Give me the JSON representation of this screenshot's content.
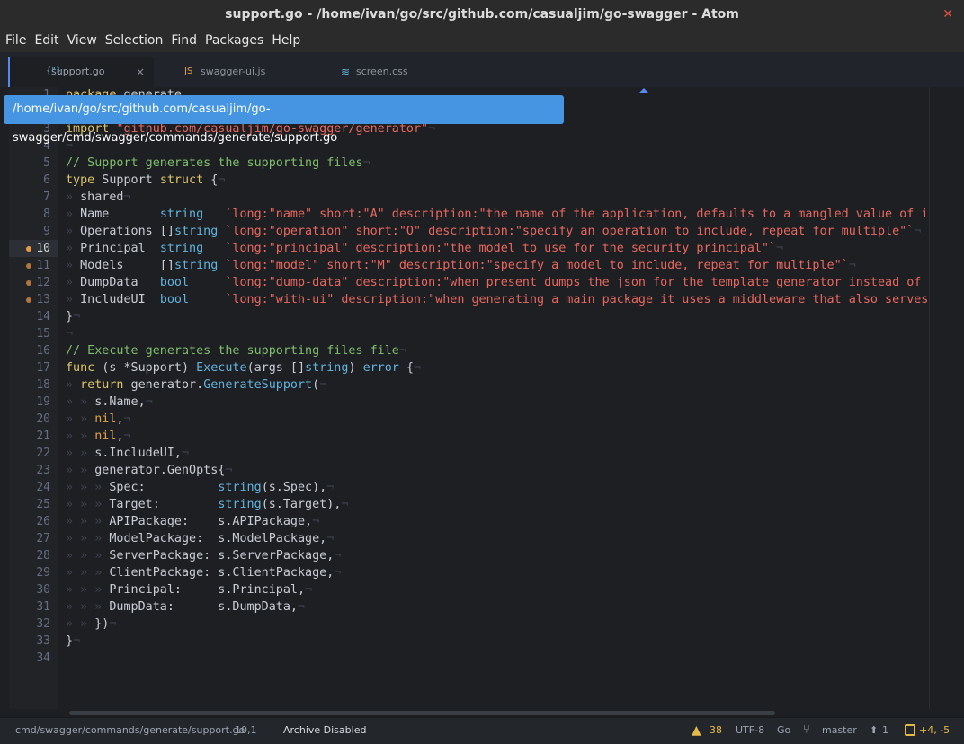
{
  "window": {
    "title": "support.go - /home/ivan/go/src/github.com/casualjim/go-swagger - Atom",
    "close_icon": "close-icon"
  },
  "menu": [
    "File",
    "Edit",
    "View",
    "Selection",
    "Find",
    "Packages",
    "Help"
  ],
  "tabs": [
    {
      "label": "support.go",
      "icon": "go-file-icon",
      "active": true,
      "close": "×"
    },
    {
      "label": "swagger-ui.js",
      "icon": "js-file-icon",
      "active": false
    },
    {
      "label": "screen.css",
      "icon": "css3-file-icon",
      "active": false
    }
  ],
  "tooltip": "/home/ivan/go/src/github.com/casualjim/go-swagger/cmd/swagger/commands/generate/support.go",
  "editor": {
    "current_line": 10,
    "modified_lines": [
      10,
      11,
      12,
      13
    ],
    "lines": [
      [
        [
          "k",
          "package"
        ],
        [
          "p",
          " generate"
        ]
      ],
      [],
      [
        [
          "k",
          "import"
        ],
        [
          "p",
          " "
        ],
        [
          "s",
          "\"github.com/casualjim/go-swagger/generator\""
        ],
        [
          "i",
          "¬"
        ]
      ],
      [
        [
          "i",
          "¬"
        ]
      ],
      [
        [
          "c",
          "// Support generates the supporting files"
        ],
        [
          "i",
          "¬"
        ]
      ],
      [
        [
          "k",
          "type"
        ],
        [
          "p",
          " Support "
        ],
        [
          "k",
          "struct"
        ],
        [
          "p",
          " {"
        ],
        [
          "i",
          "¬"
        ]
      ],
      [
        [
          "i",
          "» "
        ],
        [
          "p",
          "shared"
        ],
        [
          "i",
          "¬"
        ]
      ],
      [
        [
          "i",
          "» "
        ],
        [
          "p",
          "Name       "
        ],
        [
          "t",
          "string"
        ],
        [
          "p",
          "   "
        ],
        [
          "s",
          "`long:\"name\" short:\"A\" description:\"the name of the application, defaults to a mangled value of info.title\"`"
        ]
      ],
      [
        [
          "i",
          "» "
        ],
        [
          "p",
          "Operations []"
        ],
        [
          "t",
          "string"
        ],
        [
          "p",
          " "
        ],
        [
          "s",
          "`long:\"operation\" short:\"O\" description:\"specify an operation to include, repeat for multiple\"`"
        ],
        [
          "i",
          "¬"
        ]
      ],
      [
        [
          "i",
          "» "
        ],
        [
          "p",
          "Principal  "
        ],
        [
          "t",
          "string"
        ],
        [
          "p",
          "   "
        ],
        [
          "s",
          "`long:\"principal\" description:\"the model to use for the security principal\"`"
        ],
        [
          "i",
          "¬"
        ]
      ],
      [
        [
          "i",
          "» "
        ],
        [
          "p",
          "Models     []"
        ],
        [
          "t",
          "string"
        ],
        [
          "p",
          " "
        ],
        [
          "s",
          "`long:\"model\" short:\"M\" description:\"specify a model to include, repeat for multiple\"`"
        ],
        [
          "i",
          "¬"
        ]
      ],
      [
        [
          "i",
          "» "
        ],
        [
          "p",
          "DumpData   "
        ],
        [
          "t",
          "bool"
        ],
        [
          "p",
          "     "
        ],
        [
          "s",
          "`long:\"dump-data\" description:\"when present dumps the json for the template generator instead of generating files\"`"
        ]
      ],
      [
        [
          "i",
          "» "
        ],
        [
          "p",
          "IncludeUI  "
        ],
        [
          "t",
          "bool"
        ],
        [
          "p",
          "     "
        ],
        [
          "s",
          "`long:\"with-ui\" description:\"when generating a main package it uses a middleware that also serves a swagger-ui\"`"
        ]
      ],
      [
        [
          "p",
          "}"
        ],
        [
          "i",
          "¬"
        ]
      ],
      [
        [
          "i",
          "¬"
        ]
      ],
      [
        [
          "c",
          "// Execute generates the supporting files file"
        ],
        [
          "i",
          "¬"
        ]
      ],
      [
        [
          "k",
          "func"
        ],
        [
          "p",
          " (s *Support) "
        ],
        [
          "f",
          "Execute"
        ],
        [
          "p",
          "(args []"
        ],
        [
          "t",
          "string"
        ],
        [
          "p",
          ") "
        ],
        [
          "t",
          "error"
        ],
        [
          "p",
          " {"
        ],
        [
          "i",
          "¬"
        ]
      ],
      [
        [
          "i",
          "» "
        ],
        [
          "k",
          "return"
        ],
        [
          "p",
          " generator."
        ],
        [
          "f",
          "GenerateSupport"
        ],
        [
          "p",
          "("
        ],
        [
          "i",
          "¬"
        ]
      ],
      [
        [
          "i",
          "» » "
        ],
        [
          "p",
          "s.Name,"
        ],
        [
          "i",
          "¬"
        ]
      ],
      [
        [
          "i",
          "» » "
        ],
        [
          "n",
          "nil"
        ],
        [
          "p",
          ","
        ],
        [
          "i",
          "¬"
        ]
      ],
      [
        [
          "i",
          "» » "
        ],
        [
          "n",
          "nil"
        ],
        [
          "p",
          ","
        ],
        [
          "i",
          "¬"
        ]
      ],
      [
        [
          "i",
          "» » "
        ],
        [
          "p",
          "s.IncludeUI,"
        ],
        [
          "i",
          "¬"
        ]
      ],
      [
        [
          "i",
          "» » "
        ],
        [
          "p",
          "generator.GenOpts{"
        ],
        [
          "i",
          "¬"
        ]
      ],
      [
        [
          "i",
          "» » » "
        ],
        [
          "p",
          "Spec:          "
        ],
        [
          "t",
          "string"
        ],
        [
          "p",
          "(s.Spec),"
        ],
        [
          "i",
          "¬"
        ]
      ],
      [
        [
          "i",
          "» » » "
        ],
        [
          "p",
          "Target:        "
        ],
        [
          "t",
          "string"
        ],
        [
          "p",
          "(s.Target),"
        ],
        [
          "i",
          "¬"
        ]
      ],
      [
        [
          "i",
          "» » » "
        ],
        [
          "p",
          "APIPackage:    s.APIPackage,"
        ],
        [
          "i",
          "¬"
        ]
      ],
      [
        [
          "i",
          "» » » "
        ],
        [
          "p",
          "ModelPackage:  s.ModelPackage,"
        ],
        [
          "i",
          "¬"
        ]
      ],
      [
        [
          "i",
          "» » » "
        ],
        [
          "p",
          "ServerPackage: s.ServerPackage,"
        ],
        [
          "i",
          "¬"
        ]
      ],
      [
        [
          "i",
          "» » » "
        ],
        [
          "p",
          "ClientPackage: s.ClientPackage,"
        ],
        [
          "i",
          "¬"
        ]
      ],
      [
        [
          "i",
          "» » » "
        ],
        [
          "p",
          "Principal:     s.Principal,"
        ],
        [
          "i",
          "¬"
        ]
      ],
      [
        [
          "i",
          "» » » "
        ],
        [
          "p",
          "DumpData:      s.DumpData,"
        ],
        [
          "i",
          "¬"
        ]
      ],
      [
        [
          "i",
          "» » "
        ],
        [
          "p",
          "})"
        ],
        [
          "i",
          "¬"
        ]
      ],
      [
        [
          "p",
          "}"
        ],
        [
          "i",
          "¬"
        ]
      ],
      []
    ]
  },
  "status": {
    "path": "cmd/swagger/commands/generate/support.go",
    "cursor": "10,1",
    "archive": "Archive Disabled",
    "warnings": "38",
    "encoding": "UTF-8",
    "grammar": "Go",
    "branch": "master",
    "ahead": "1",
    "diff": "+4, -5"
  },
  "colors": {
    "accent": "#4595e2",
    "keyword": "#dcc46a",
    "string": "#e8685f",
    "comment": "#7fbf6b",
    "type": "#62b3dc",
    "constant": "#e2a24a",
    "warning": "#e5b84a"
  }
}
